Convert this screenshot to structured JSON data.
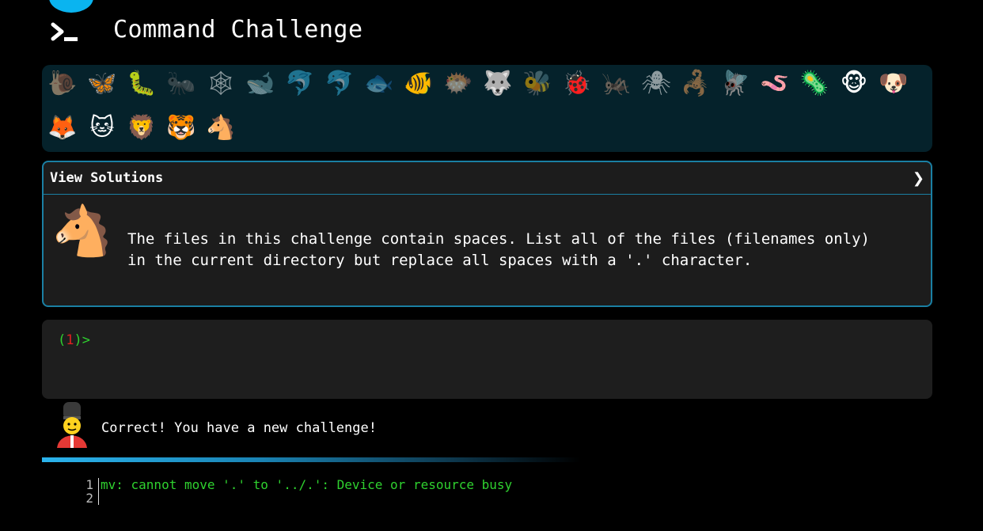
{
  "header": {
    "title": "Command Challenge",
    "logo_icon": "terminal-icon",
    "accent": "#0ab4f0"
  },
  "animals": [
    {
      "icon": "snail",
      "glyph": "🐌",
      "done": false
    },
    {
      "icon": "butterfly",
      "glyph": "🦋",
      "done": true
    },
    {
      "icon": "caterpillar",
      "glyph": "🐛",
      "done": true
    },
    {
      "icon": "ant",
      "glyph": "🐜",
      "done": false
    },
    {
      "icon": "spider-web",
      "glyph": "🕸",
      "done": false
    },
    {
      "icon": "whale",
      "glyph": "🐋",
      "done": false
    },
    {
      "icon": "dolphin",
      "glyph": "🐬",
      "done": false
    },
    {
      "icon": "dolphin",
      "glyph": "🐬",
      "done": false
    },
    {
      "icon": "fish",
      "glyph": "🐟",
      "done": false
    },
    {
      "icon": "tropical-fish",
      "glyph": "🐠",
      "done": true
    },
    {
      "icon": "blowfish",
      "glyph": "🐡",
      "done": false
    },
    {
      "icon": "wolf",
      "glyph": "🐺",
      "done": true
    },
    {
      "icon": "bee",
      "glyph": "🐝",
      "done": false
    },
    {
      "icon": "ladybug",
      "glyph": "🐞",
      "done": true
    },
    {
      "icon": "cricket",
      "glyph": "🦗",
      "done": false
    },
    {
      "icon": "spider",
      "glyph": "🕷",
      "done": false
    },
    {
      "icon": "scorpion",
      "glyph": "🦂",
      "done": false
    },
    {
      "icon": "fly",
      "glyph": "🪰",
      "done": true
    },
    {
      "icon": "worm",
      "glyph": "🪱",
      "done": true
    },
    {
      "icon": "microbe",
      "glyph": "🦠",
      "done": true
    },
    {
      "icon": "monkey",
      "glyph": "🐵",
      "done": true
    },
    {
      "icon": "dog",
      "glyph": "🐶",
      "done": true
    },
    {
      "icon": "fox",
      "glyph": "🦊",
      "done": true
    },
    {
      "icon": "cat",
      "glyph": "🐱",
      "done": true
    },
    {
      "icon": "lion",
      "glyph": "🦁",
      "done": true
    },
    {
      "icon": "tiger",
      "glyph": "🐯",
      "done": true
    },
    {
      "icon": "horse",
      "glyph": "🐴",
      "done": true
    }
  ],
  "solutions": {
    "label": "View Solutions",
    "chevron": "❯",
    "challenge_icon": "🐴",
    "description": "The files in this challenge contain spaces. List all of the files (filenames only)\nin the current directory but replace all spaces with a '.' character."
  },
  "terminal": {
    "open": "(",
    "number": "1",
    "close": ")>"
  },
  "status": {
    "message": "Correct! You have a new challenge!"
  },
  "output": {
    "line_numbers": [
      "1",
      "2"
    ],
    "text": "mv: cannot move '.' to '../.': Device or resource busy"
  }
}
